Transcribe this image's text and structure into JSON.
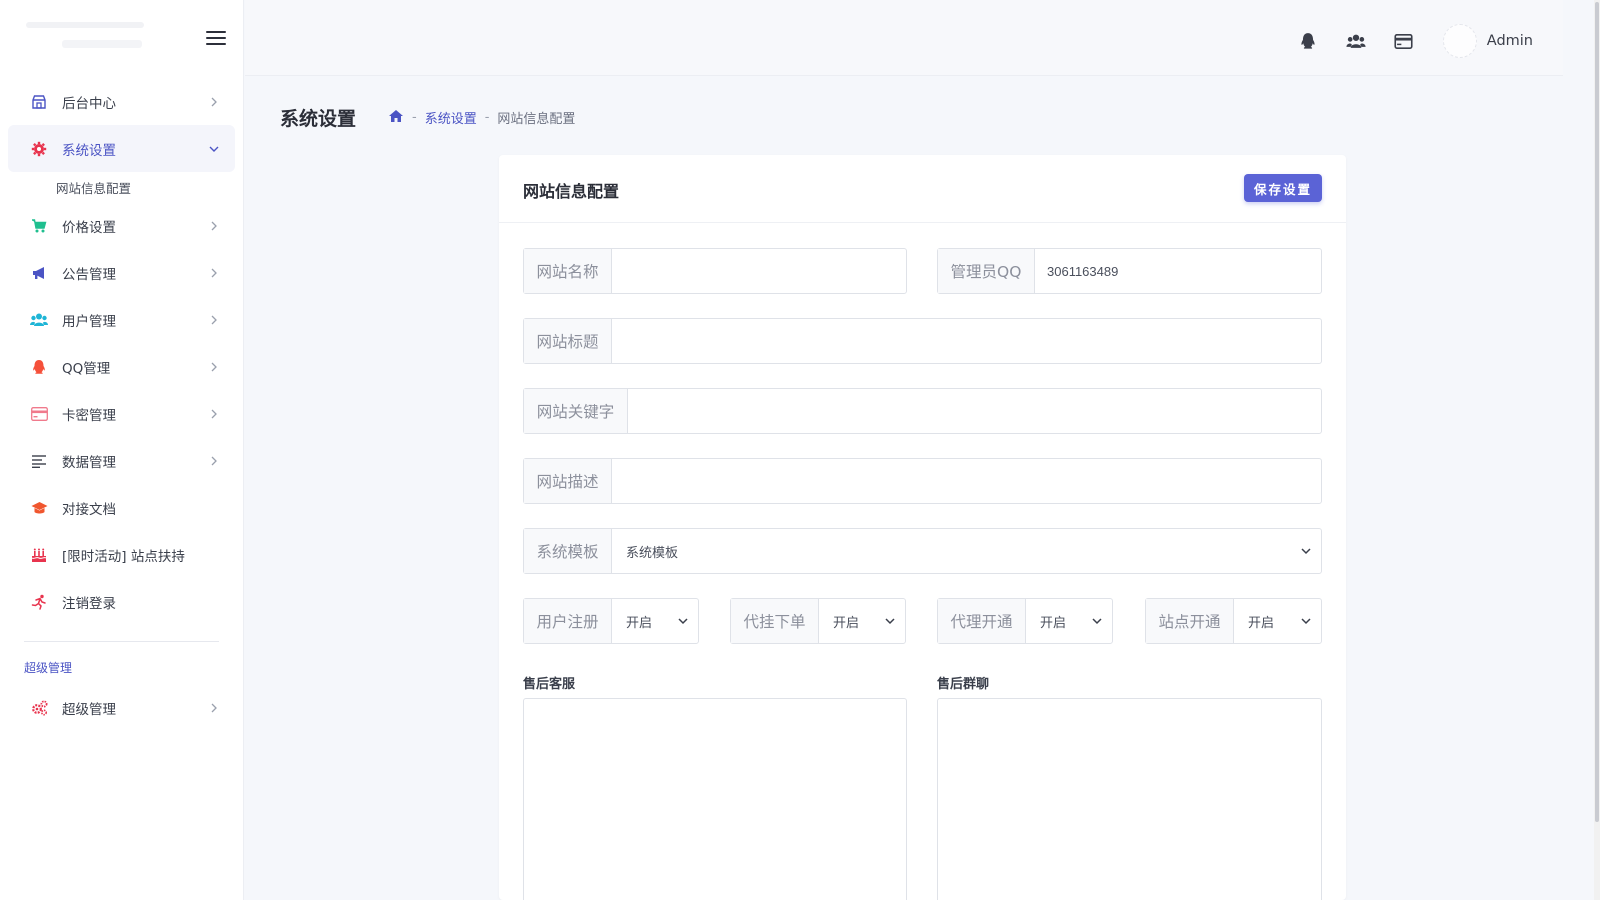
{
  "sidebar": {
    "items": [
      {
        "label": "后台中心",
        "icon": "store-icon",
        "has_chevron": true
      },
      {
        "label": "系统设置",
        "icon": "gear-icon",
        "has_chevron": true,
        "active": true
      },
      {
        "label": "价格设置",
        "icon": "cart-icon",
        "has_chevron": true
      },
      {
        "label": "公告管理",
        "icon": "megaphone-icon",
        "has_chevron": true
      },
      {
        "label": "用户管理",
        "icon": "users-icon",
        "has_chevron": true
      },
      {
        "label": "QQ管理",
        "icon": "qq-icon",
        "has_chevron": true
      },
      {
        "label": "卡密管理",
        "icon": "card-icon",
        "has_chevron": true
      },
      {
        "label": "数据管理",
        "icon": "list-icon",
        "has_chevron": true
      },
      {
        "label": "对接文档",
        "icon": "graduation-cap-icon",
        "has_chevron": false
      },
      {
        "label": "[限时活动] 站点扶持",
        "icon": "cake-icon",
        "has_chevron": false
      },
      {
        "label": "注销登录",
        "icon": "runner-icon",
        "has_chevron": false
      }
    ],
    "sub_item": "网站信息配置",
    "section_title": "超级管理",
    "super_item": {
      "label": "超级管理",
      "icon": "cogs-icon"
    }
  },
  "topbar": {
    "admin_name": "Admin"
  },
  "page": {
    "title": "系统设置",
    "breadcrumb": {
      "sep": "-",
      "level1": "系统设置",
      "level2": "网站信息配置"
    }
  },
  "card": {
    "title": "网站信息配置",
    "save_label": "保存设置",
    "fields": {
      "site_name_label": "网站名称",
      "site_name_value": "",
      "admin_qq_label": "管理员QQ",
      "admin_qq_value": "3061163489",
      "site_title_label": "网站标题",
      "site_title_value": "",
      "keywords_label": "网站关键字",
      "keywords_value": "",
      "description_label": "网站描述",
      "description_value": "",
      "template_label": "系统模板",
      "template_value": "系统模板",
      "user_register_label": "用户注册",
      "user_register_value": "开启",
      "proxy_order_label": "代挂下单",
      "proxy_order_value": "开启",
      "agent_open_label": "代理开通",
      "agent_open_value": "开启",
      "site_open_label": "站点开通",
      "site_open_value": "开启"
    },
    "after_sale_service_label": "售后客服",
    "after_sale_group_label": "售后群聊"
  },
  "colors": {
    "accent": "#4b54c4",
    "button": "#5b63d6"
  }
}
